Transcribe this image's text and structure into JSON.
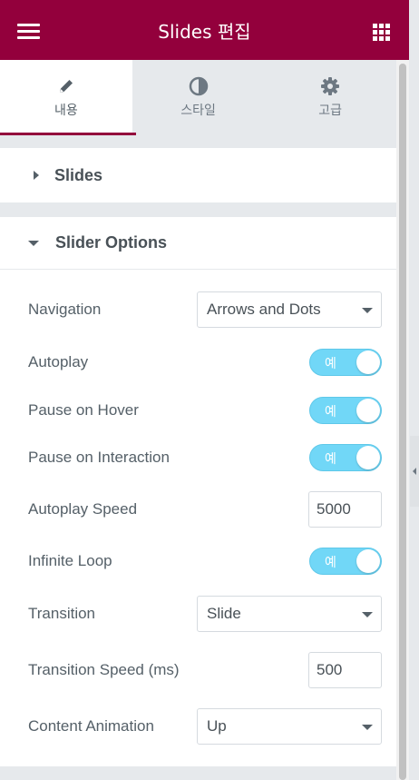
{
  "header": {
    "title": "Slides 편집",
    "menu_icon": "hamburger-icon",
    "apps_icon": "grid-icon",
    "brand_color": "#93003c"
  },
  "tabs": [
    {
      "label": "내용",
      "icon": "pencil-icon",
      "active": true
    },
    {
      "label": "스타일",
      "icon": "contrast-icon",
      "active": false
    },
    {
      "label": "고급",
      "icon": "gear-icon",
      "active": false
    }
  ],
  "sections": {
    "slides": {
      "title": "Slides",
      "expanded": false
    },
    "slider_options": {
      "title": "Slider Options",
      "expanded": true
    }
  },
  "controls": {
    "navigation": {
      "label": "Navigation",
      "value": "Arrows and Dots"
    },
    "autoplay": {
      "label": "Autoplay",
      "toggle_text": "예"
    },
    "pause_on_hover": {
      "label": "Pause on Hover",
      "toggle_text": "예"
    },
    "pause_on_interaction": {
      "label": "Pause on Interaction",
      "toggle_text": "예"
    },
    "autoplay_speed": {
      "label": "Autoplay Speed",
      "value": "5000"
    },
    "infinite_loop": {
      "label": "Infinite Loop",
      "toggle_text": "예"
    },
    "transition": {
      "label": "Transition",
      "value": "Slide"
    },
    "transition_speed": {
      "label": "Transition Speed (ms)",
      "value": "500"
    },
    "content_animation": {
      "label": "Content Animation",
      "value": "Up"
    }
  },
  "colors": {
    "toggle_on": "#71d7f7",
    "active_tab_underline": "#93003c"
  }
}
